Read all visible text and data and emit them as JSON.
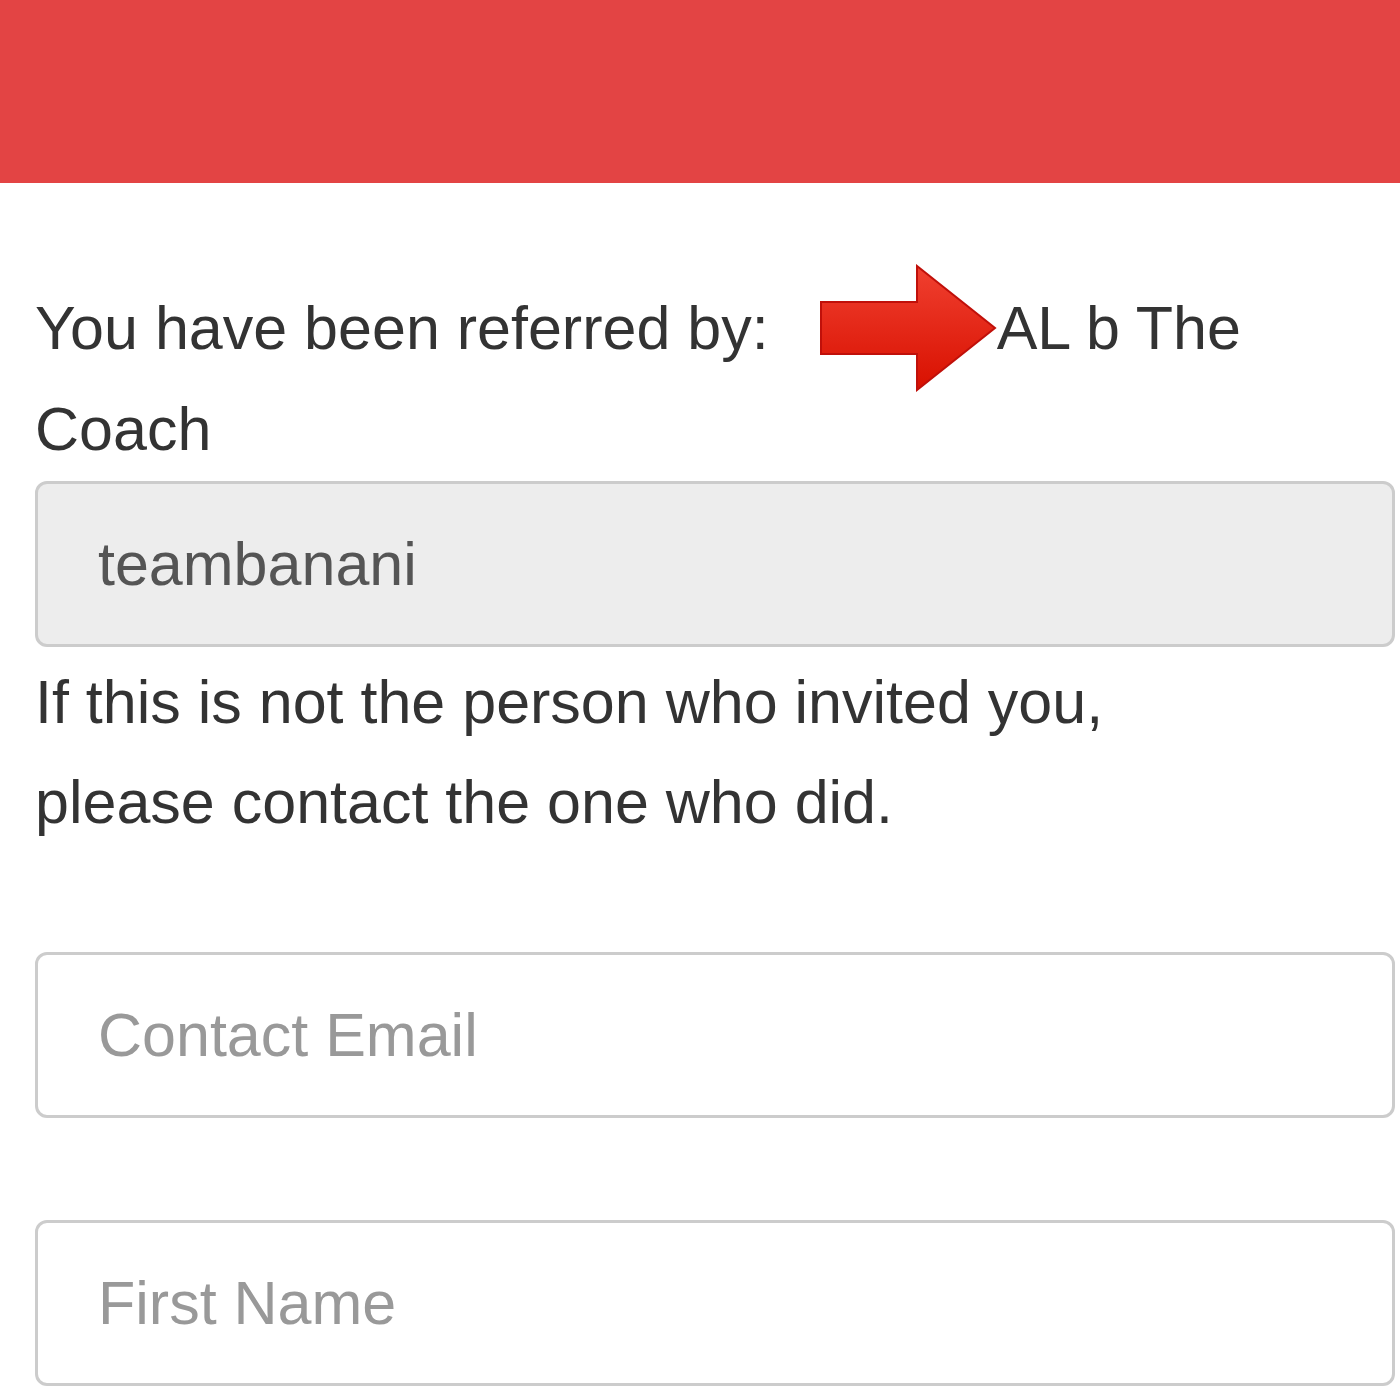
{
  "referral": {
    "label": "You have been referred by:",
    "referrer": "AL b The"
  },
  "coach": {
    "label": "Coach",
    "value": "teambanani",
    "disabled": true
  },
  "notice": "If this is not the person who invited you, please contact the one who did.",
  "fields": [
    {
      "placeholder": "Contact Email"
    },
    {
      "placeholder": "First Name"
    }
  ]
}
